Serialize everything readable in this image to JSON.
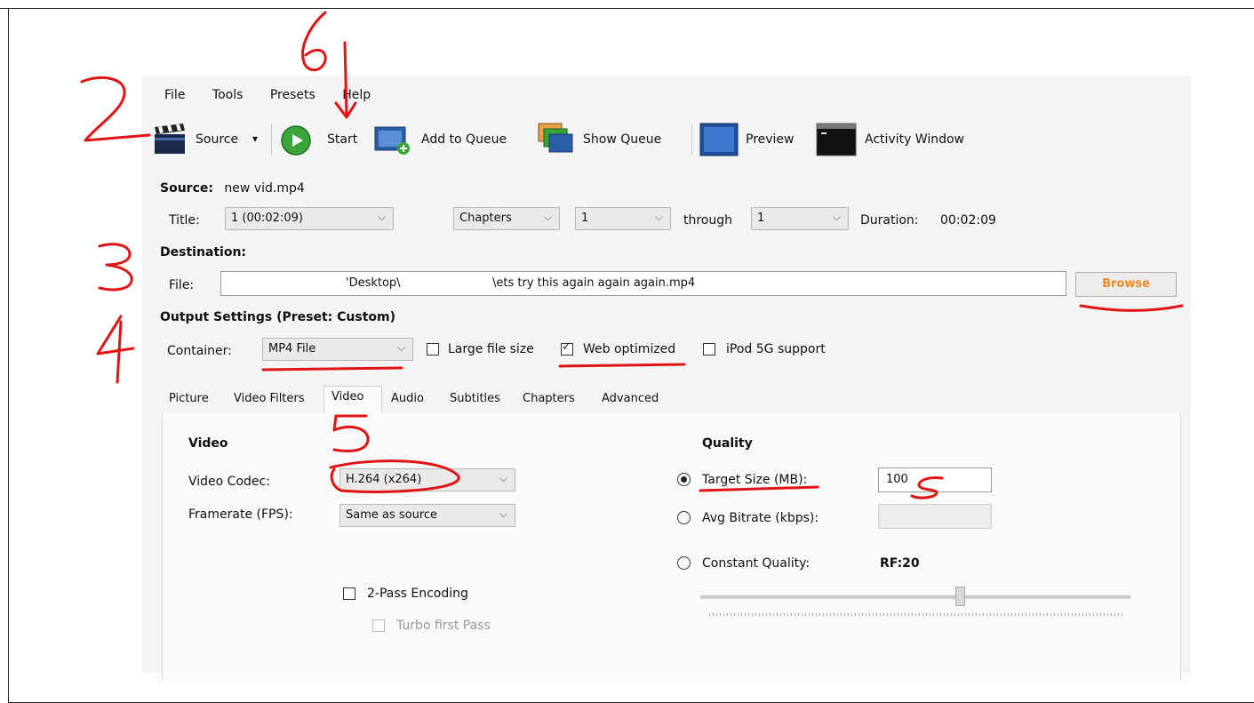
{
  "menu": [
    "File",
    "Tools",
    "Presets",
    "Help"
  ],
  "toolbar": {
    "source": "Source",
    "source_arrow": "▾",
    "start": "Start",
    "add_to_queue": "Add to Queue",
    "show_queue": "Show Queue",
    "preview": "Preview",
    "activity_window": "Activity Window"
  },
  "source": {
    "label": "Source:",
    "value": "new vid.mp4"
  },
  "title_row": {
    "title_label": "Title:",
    "title_value": "1 (00:02:09)",
    "chapters_mode": "Chapters",
    "chapter_start": "1",
    "through_label": "through",
    "chapter_end": "1",
    "duration_label": "Duration:",
    "duration_value": "00:02:09"
  },
  "destination": {
    "heading": "Destination:",
    "file_label": "File:",
    "file_part1": "'Desktop\\",
    "file_part2": "\\ets try this again again again.mp4",
    "browse": "Browse"
  },
  "output": {
    "heading": "Output Settings (Preset: Custom)",
    "container_label": "Container:",
    "container_value": "MP4 File",
    "large_file_size": "Large file size",
    "large_file_size_checked": false,
    "web_optimized": "Web optimized",
    "web_optimized_checked": true,
    "ipod_support": "iPod 5G support",
    "ipod_support_checked": false
  },
  "tabs": [
    "Picture",
    "Video Filters",
    "Video",
    "Audio",
    "Subtitles",
    "Chapters",
    "Advanced"
  ],
  "active_tab": "Video",
  "video": {
    "heading": "Video",
    "codec_label": "Video Codec:",
    "codec_value": "H.264 (x264)",
    "framerate_label": "Framerate (FPS):",
    "framerate_value": "Same as source",
    "two_pass": "2-Pass Encoding",
    "turbo": "Turbo first Pass"
  },
  "quality": {
    "heading": "Quality",
    "target_size_label": "Target Size (MB):",
    "target_size_value": "100",
    "avg_bitrate_label": "Avg Bitrate (kbps):",
    "constant_quality_label": "Constant Quality:",
    "rf_label": "RF:20",
    "selected_mode": "Target Size (MB)"
  },
  "annotations": [
    "2",
    "3",
    "4",
    "5",
    "6",
    "s"
  ],
  "colors": {
    "annotation": "#e01414",
    "browse_text": "#f08a24",
    "start_green": "#3aa63a"
  }
}
